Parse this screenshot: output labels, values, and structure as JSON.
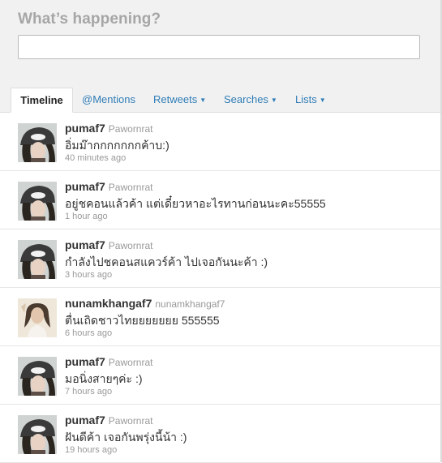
{
  "compose": {
    "heading": "What’s happening?",
    "input_value": "",
    "input_placeholder": ""
  },
  "tabs": [
    {
      "label": "Timeline",
      "active": true,
      "has_menu": false
    },
    {
      "label": "@Mentions",
      "active": false,
      "has_menu": false
    },
    {
      "label": "Retweets",
      "active": false,
      "has_menu": true
    },
    {
      "label": "Searches",
      "active": false,
      "has_menu": true
    },
    {
      "label": "Lists",
      "active": false,
      "has_menu": true
    }
  ],
  "tab_caret_icon": "caret-down-icon",
  "tweets": [
    {
      "screen_name": "pumaf7",
      "full_name": "Pawornrat",
      "text": "อิ่มม๊ากกกกกกกค้าบ:)",
      "time": "40 minutes ago",
      "avatar": "pumaf7-avatar"
    },
    {
      "screen_name": "pumaf7",
      "full_name": "Pawornrat",
      "text": "อยู่ชคอนแล้วค้า แต่เดี๋ยวหาอะไรทานก่อนนะคะ55555",
      "time": "1 hour ago",
      "avatar": "pumaf7-avatar"
    },
    {
      "screen_name": "pumaf7",
      "full_name": "Pawornrat",
      "text": "กำลังไปชคอนสแควร์ค้า ไปเจอกันนะค้า :)",
      "time": "3 hours ago",
      "avatar": "pumaf7-avatar"
    },
    {
      "screen_name": "nunamkhangaf7",
      "full_name": "nunamkhangaf7",
      "text": "ตื่นเถิดชาวไทยยยยยยย 555555",
      "time": "6 hours ago",
      "avatar": "nunamkhangaf7-avatar"
    },
    {
      "screen_name": "pumaf7",
      "full_name": "Pawornrat",
      "text": "มอนิ่งสายๆค่ะ :)",
      "time": "7 hours ago",
      "avatar": "pumaf7-avatar"
    },
    {
      "screen_name": "pumaf7",
      "full_name": "Pawornrat",
      "text": "ฝันดีค้า เจอกันพรุ่งนี้น้า :)",
      "time": "19 hours ago",
      "avatar": "pumaf7-avatar"
    }
  ],
  "colors": {
    "link": "#2f7db7",
    "header_bg": "#f1f1f1",
    "muted": "#999999"
  }
}
